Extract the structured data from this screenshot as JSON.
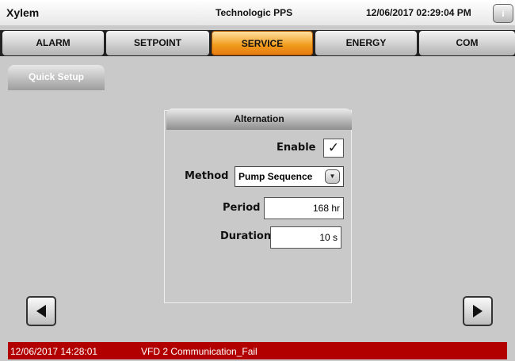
{
  "header": {
    "brand": "Xylem",
    "title": "Technologic PPS",
    "datetime": "12/06/2017 02:29:04 PM",
    "info_label": "i"
  },
  "tabs": [
    {
      "label": "ALARM",
      "active": false
    },
    {
      "label": "SETPOINT",
      "active": false
    },
    {
      "label": "SERVICE",
      "active": true
    },
    {
      "label": "ENERGY",
      "active": false
    },
    {
      "label": "COM",
      "active": false
    }
  ],
  "subnav": {
    "quick_setup": "Quick Setup"
  },
  "alternation": {
    "title": "Alternation",
    "enable_label": "Enable",
    "enable_checked": true,
    "enable_mark": "✓",
    "method_label": "Method",
    "method_value": "Pump Sequence",
    "method_arrow": "▼",
    "period_label": "Period",
    "period_value": "168 hr",
    "duration_label": "Duration",
    "duration_value": "10 s"
  },
  "nav": {
    "prev_icon": "triangle-left",
    "next_icon": "triangle-right"
  },
  "alarm_bar": {
    "timestamp": "12/06/2017 14:28:01",
    "message": "VFD 2 Communication_Fail",
    "color": "#b20000"
  },
  "colors": {
    "accent": "#f09a1a",
    "background": "#c9c9c9"
  }
}
